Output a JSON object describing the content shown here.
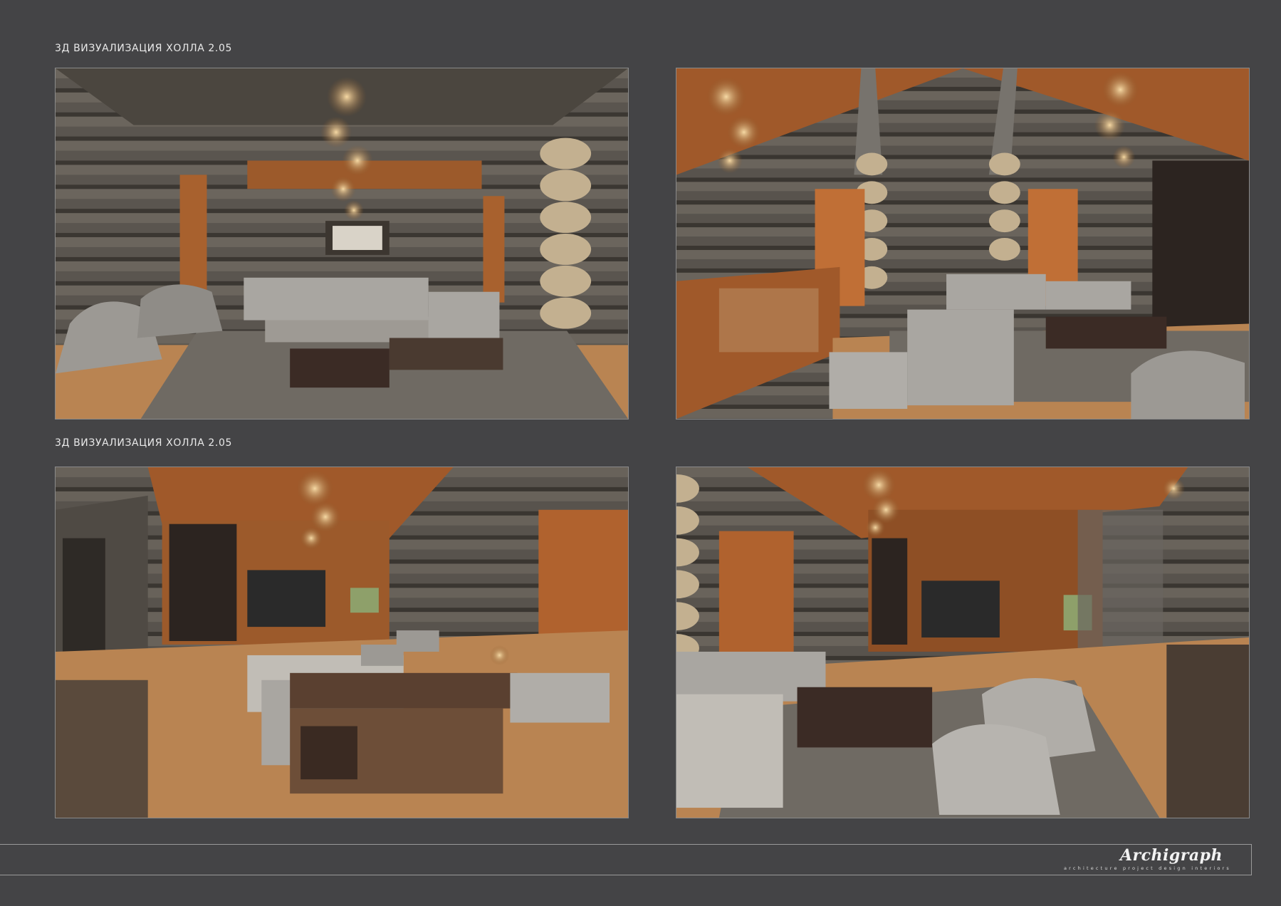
{
  "captions": {
    "top": "3Д ВИЗУАЛИЗАЦИЯ ХОЛЛА 2.05",
    "bottom": "3Д ВИЗУАЛИЗАЦИЯ ХОЛЛА 2.05"
  },
  "renders": [
    {
      "view": "living area with sofa, armchairs and chandelier toward glass wall"
    },
    {
      "view": "hall with staircase railing, sofa and two doors between log columns"
    },
    {
      "view": "sofa with shelving console facing media wall and window"
    },
    {
      "view": "sofa, armchairs and coffee table facing media wall"
    }
  ],
  "footer": {
    "brand": "Archigraph",
    "tagline": "architecture  project  design  interiors"
  },
  "colors": {
    "background": "#444446",
    "log_wall": "#5b5650",
    "wood": "#a8612e",
    "floor": "#b98452",
    "upholstery": "#a9a6a1"
  }
}
